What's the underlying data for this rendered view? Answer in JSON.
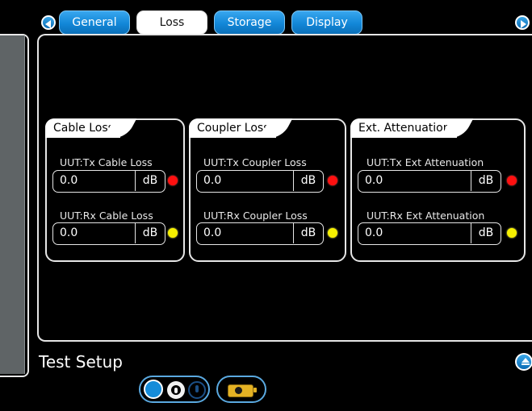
{
  "tabs": [
    {
      "label": "General",
      "active": false
    },
    {
      "label": "Loss",
      "active": true
    },
    {
      "label": "Storage",
      "active": false
    },
    {
      "label": "Display",
      "active": false
    }
  ],
  "groups": [
    {
      "title": "Cable Loss",
      "fields": [
        {
          "label": "UUT:Tx Cable Loss",
          "value": "0.0",
          "unit": "dB",
          "indicator": "red"
        },
        {
          "label": "UUT:Rx Cable Loss",
          "value": "0.0",
          "unit": "dB",
          "indicator": "yellow"
        }
      ]
    },
    {
      "title": "Coupler Loss",
      "fields": [
        {
          "label": "UUT:Tx Coupler Loss",
          "value": "0.0",
          "unit": "dB",
          "indicator": "red"
        },
        {
          "label": "UUT:Rx Coupler Loss",
          "value": "0.0",
          "unit": "dB",
          "indicator": "yellow"
        }
      ]
    },
    {
      "title": "Ext. Attenuation",
      "fields": [
        {
          "label": "UUT:Tx Ext Attenuation",
          "value": "0.0",
          "unit": "dB",
          "indicator": "red"
        },
        {
          "label": "UUT:Rx Ext Attenuation",
          "value": "0.0",
          "unit": "dB",
          "indicator": "yellow"
        }
      ]
    }
  ],
  "page_title": "Test Setup",
  "colors": {
    "tab_blue": "#1287d8",
    "indicator_red": "#ff1010",
    "indicator_yellow": "#f6f000",
    "battery": "#e4b224"
  },
  "icons": {
    "prev": "chevron-left-icon",
    "next": "chevron-right-icon",
    "scroll_up": "scroll-top-icon",
    "battery": "battery-icon"
  }
}
